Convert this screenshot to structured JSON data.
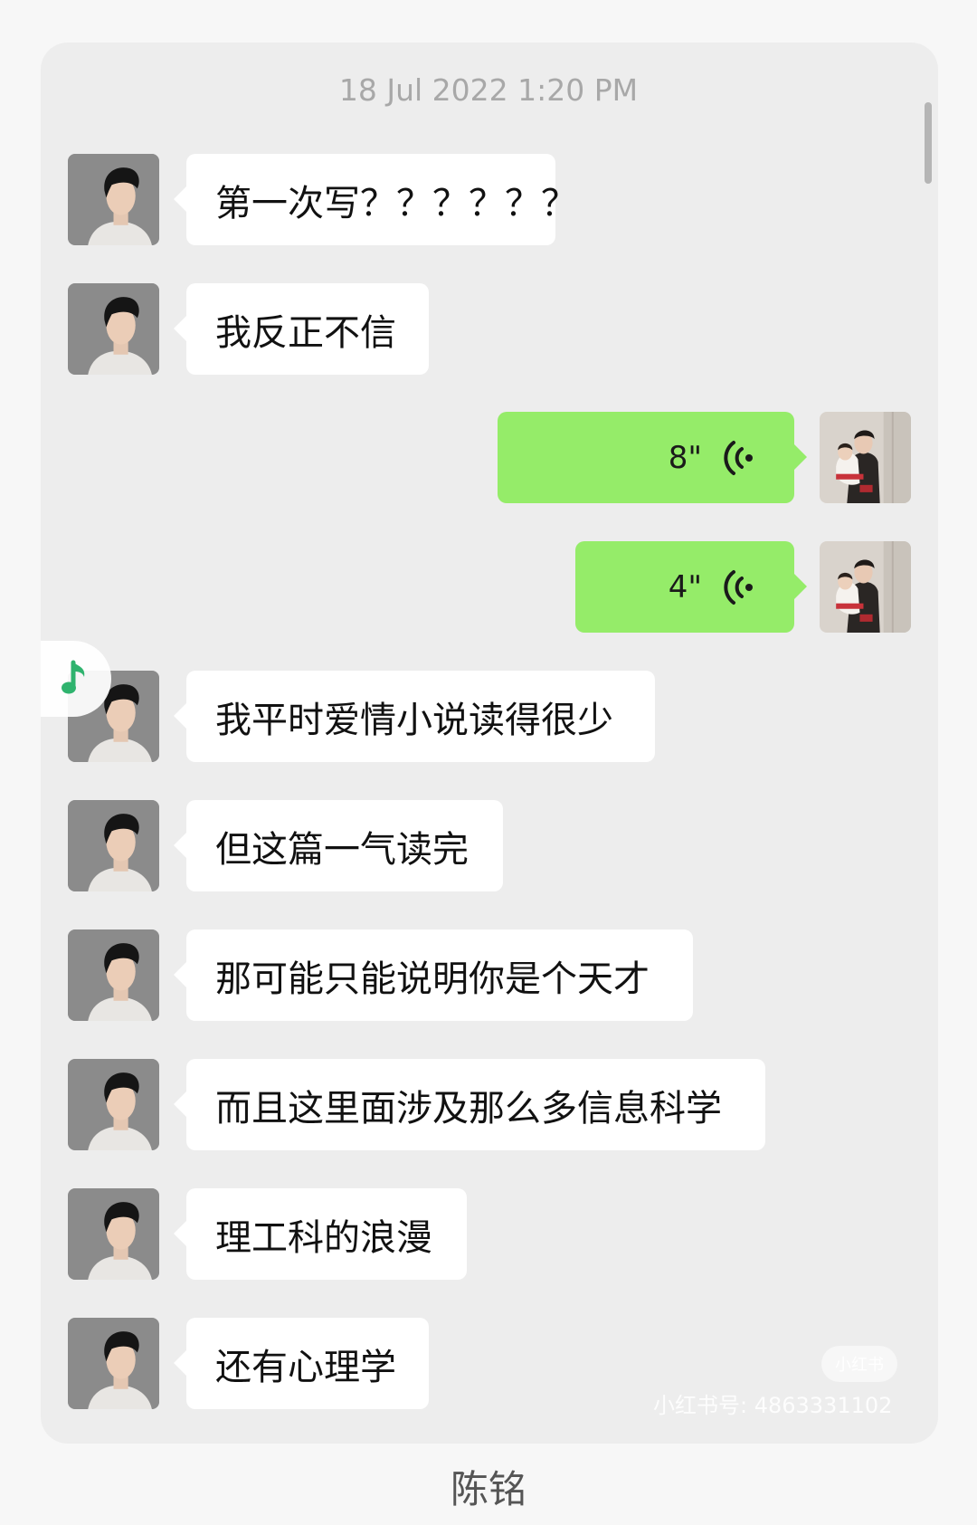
{
  "chat": {
    "timestamp": "18 Jul 2022 1:20 PM",
    "messages": [
      {
        "side": "in",
        "type": "text",
        "text": "第一次写？？？？？？"
      },
      {
        "side": "in",
        "type": "text",
        "text": "我反正不信"
      },
      {
        "side": "out",
        "type": "voice",
        "duration": "8\"",
        "icon": "voice-wave-icon"
      },
      {
        "side": "out",
        "type": "voice",
        "duration": "4\"",
        "icon": "voice-wave-icon"
      },
      {
        "side": "in",
        "type": "text",
        "text": "我平时爱情小说读得很少"
      },
      {
        "side": "in",
        "type": "text",
        "text": "但这篇一气读完"
      },
      {
        "side": "in",
        "type": "text",
        "text": "那可能只能说明你是个天才"
      },
      {
        "side": "in",
        "type": "text",
        "text": "而且这里面涉及那么多信息科学"
      },
      {
        "side": "in",
        "type": "text",
        "text": "理工科的浪漫"
      },
      {
        "side": "in",
        "type": "text",
        "text": "还有心理学"
      }
    ]
  },
  "floating_music": {
    "icon": "music-note-icon",
    "color": "#2fb36e"
  },
  "watermark": {
    "logo": "小红书",
    "id": "小红书号: 4863331102"
  },
  "caption": "陈铭",
  "colors": {
    "outgoing_bubble": "#95ec69",
    "incoming_bubble": "#ffffff",
    "chat_background": "#ededed"
  }
}
